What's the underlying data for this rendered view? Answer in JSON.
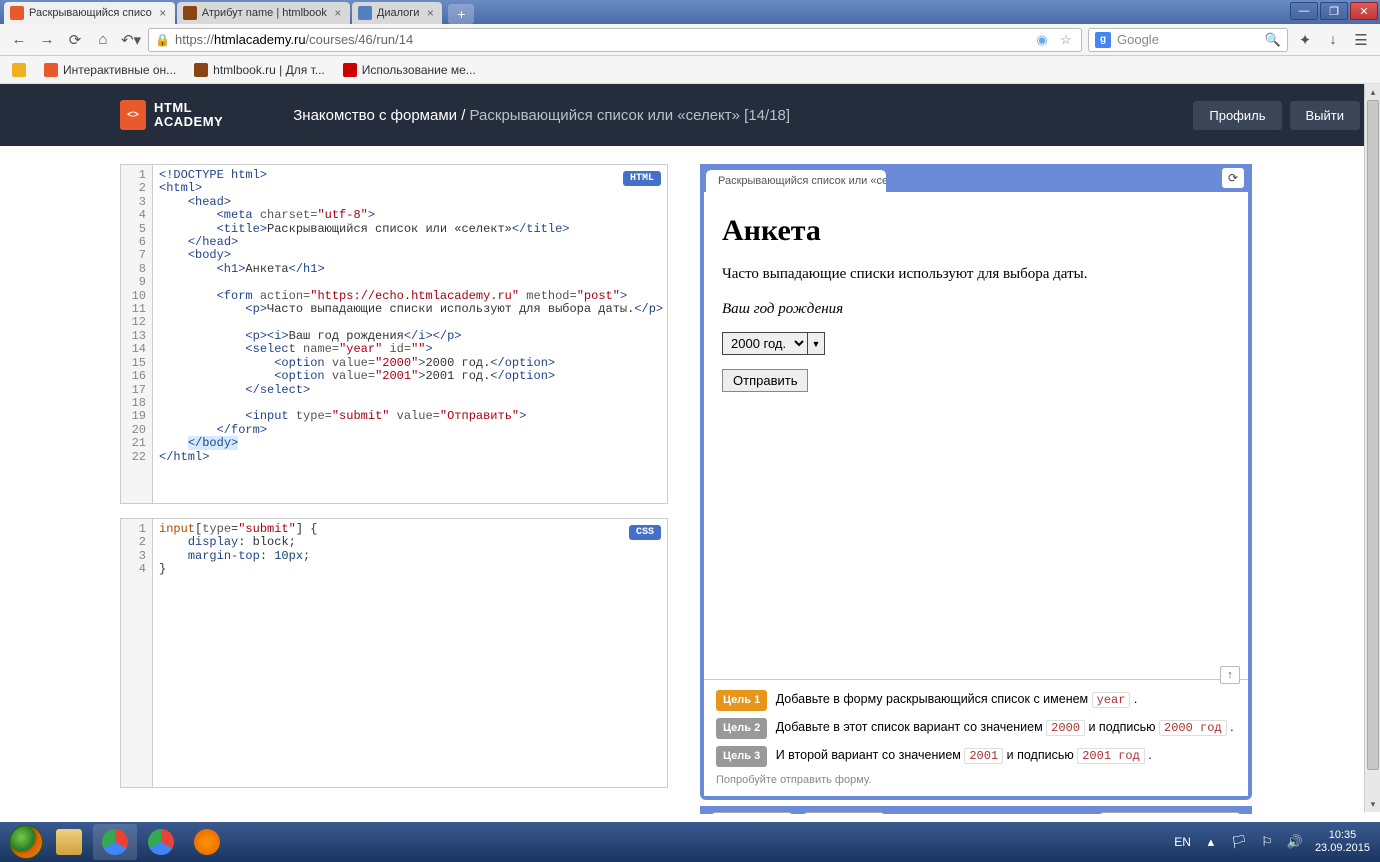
{
  "browser": {
    "tabs": [
      {
        "title": "Раскрывающийся списо"
      },
      {
        "title": "Атрибут name | htmlbook"
      },
      {
        "title": "Диалоги"
      }
    ],
    "url_prefix": "https://",
    "url_domain": "htmlacademy.ru",
    "url_path": "/courses/46/run/14",
    "search_placeholder": "Google",
    "bookmarks": [
      {
        "label": "Интерактивные он..."
      },
      {
        "label": "htmlbook.ru | Для т..."
      },
      {
        "label": "Использование ме..."
      }
    ]
  },
  "header": {
    "logo_line1": "HTML",
    "logo_line2": "ACADEMY",
    "course": "Знакомство с формами /",
    "lesson": " Раскрывающийся список или «селект» [14/18]",
    "profile": "Профиль",
    "logout": "Выйти"
  },
  "editor_html": {
    "badge": "HTML",
    "lines": 22
  },
  "editor_css": {
    "badge": "CSS",
    "lines": 4
  },
  "preview": {
    "tab_title": "Раскрывающийся список или «сел",
    "h1": "Анкета",
    "p1": "Часто выпадающие списки используют для выбора даты.",
    "p2": "Ваш год рождения",
    "select_value": "2000 год.",
    "submit_label": "Отправить"
  },
  "goals": {
    "g1_badge": "Цель 1",
    "g1_text_a": "Добавьте в форму раскрывающийся список с именем ",
    "g1_code": "year",
    "g2_badge": "Цель 2",
    "g2_text_a": "Добавьте в этот список вариант со значением ",
    "g2_code1": "2000",
    "g2_text_b": " и подписью ",
    "g2_code2": "2000 год",
    "g3_badge": "Цель 3",
    "g3_text_a": "И второй вариант со значением ",
    "g3_code1": "2001",
    "g3_text_b": " и подписью ",
    "g3_code2": "2001 год",
    "hint": "Попробуйте отправить форму."
  },
  "tray": {
    "lang": "EN",
    "time": "10:35",
    "date": "23.09.2015"
  }
}
